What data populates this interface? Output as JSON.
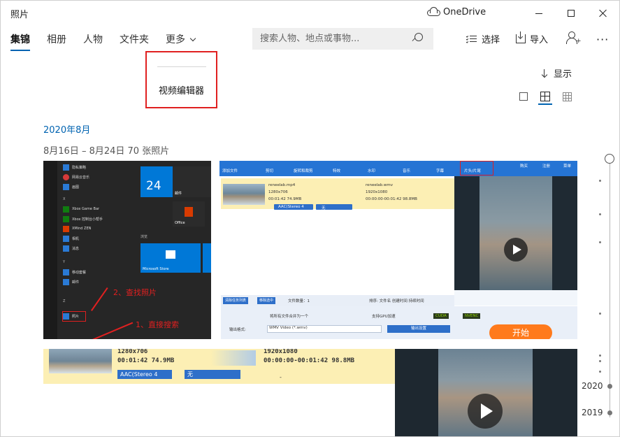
{
  "window": {
    "app_title": "照片",
    "onedrive_label": "OneDrive"
  },
  "nav": {
    "tabs": [
      {
        "label": "集锦",
        "active": true
      },
      {
        "label": "相册"
      },
      {
        "label": "人物"
      },
      {
        "label": "文件夹"
      },
      {
        "label": "更多"
      }
    ],
    "search_placeholder": "搜索人物、地点或事物...",
    "select_label": "选择",
    "import_label": "导入",
    "more_dots": "···"
  },
  "dropdown": {
    "item": "视频编辑器",
    "highlight_color": "#e02020"
  },
  "view": {
    "show_label": "显示"
  },
  "gallery": {
    "month": "2020年8月",
    "date_range": "8月16日 – 8月24日   70 张照片"
  },
  "thumb1": {
    "items": [
      "隐私策略",
      "网易云音乐",
      "画图",
      "X",
      "Xbox Game Bar",
      "Xbox 控制台小帮手",
      "XMind ZEN",
      "相机",
      "消息",
      "Y",
      "移动套餐",
      "邮件",
      "Z",
      "照片"
    ],
    "tile_day": "24",
    "tile_mail": "邮件",
    "tile_office": "Office",
    "tile_store": "Microsoft Store",
    "section_browse": "浏览",
    "anno_find": "2、查找照片",
    "anno_search": "1、直接搜索"
  },
  "thumb2": {
    "toolbar": [
      "添加文件",
      "剪切",
      "旋转和裁剪",
      "特效",
      "水印",
      "音乐",
      "字幕",
      "片头/片尾"
    ],
    "top_right": [
      "购买",
      "注册",
      "菜单"
    ],
    "src_name": "reneelab.mp4",
    "src_res": "1280x706",
    "src_dur": "00:01:42  74.9MB",
    "dst_name": "reneelab.wmv",
    "dst_res": "1920x1080",
    "dst_dur": "00:00:00-00:01:42  98.8MB",
    "audio": "AAC(Stereo 4",
    "subtitle": "无",
    "clear_btn": "清除任务列表",
    "remove_btn": "移除选中",
    "file_count": "文件数量：1",
    "sort": "排序: 文件名   创建时间   持续时间",
    "merge": "将所有文件合并为一个",
    "gpu": "支持GPU加速",
    "cuda": "CUDA",
    "nvenc": "NVENC",
    "format_label": "输出格式:",
    "format_value": "WMV Video (*.wmv)",
    "output_settings": "输出设置",
    "start_label": "开始"
  },
  "thumb3": {
    "src_res": "1280x706",
    "src_dur": "00:01:42  74.9MB",
    "dst_res": "1920x1080",
    "dst_dur": "00:00:00-00:01:42  98.8MB",
    "audio": "AAC(Stereo 4",
    "subtitle": "无",
    "dash": "-"
  },
  "timeline": {
    "years": [
      "2020",
      "2019"
    ]
  }
}
